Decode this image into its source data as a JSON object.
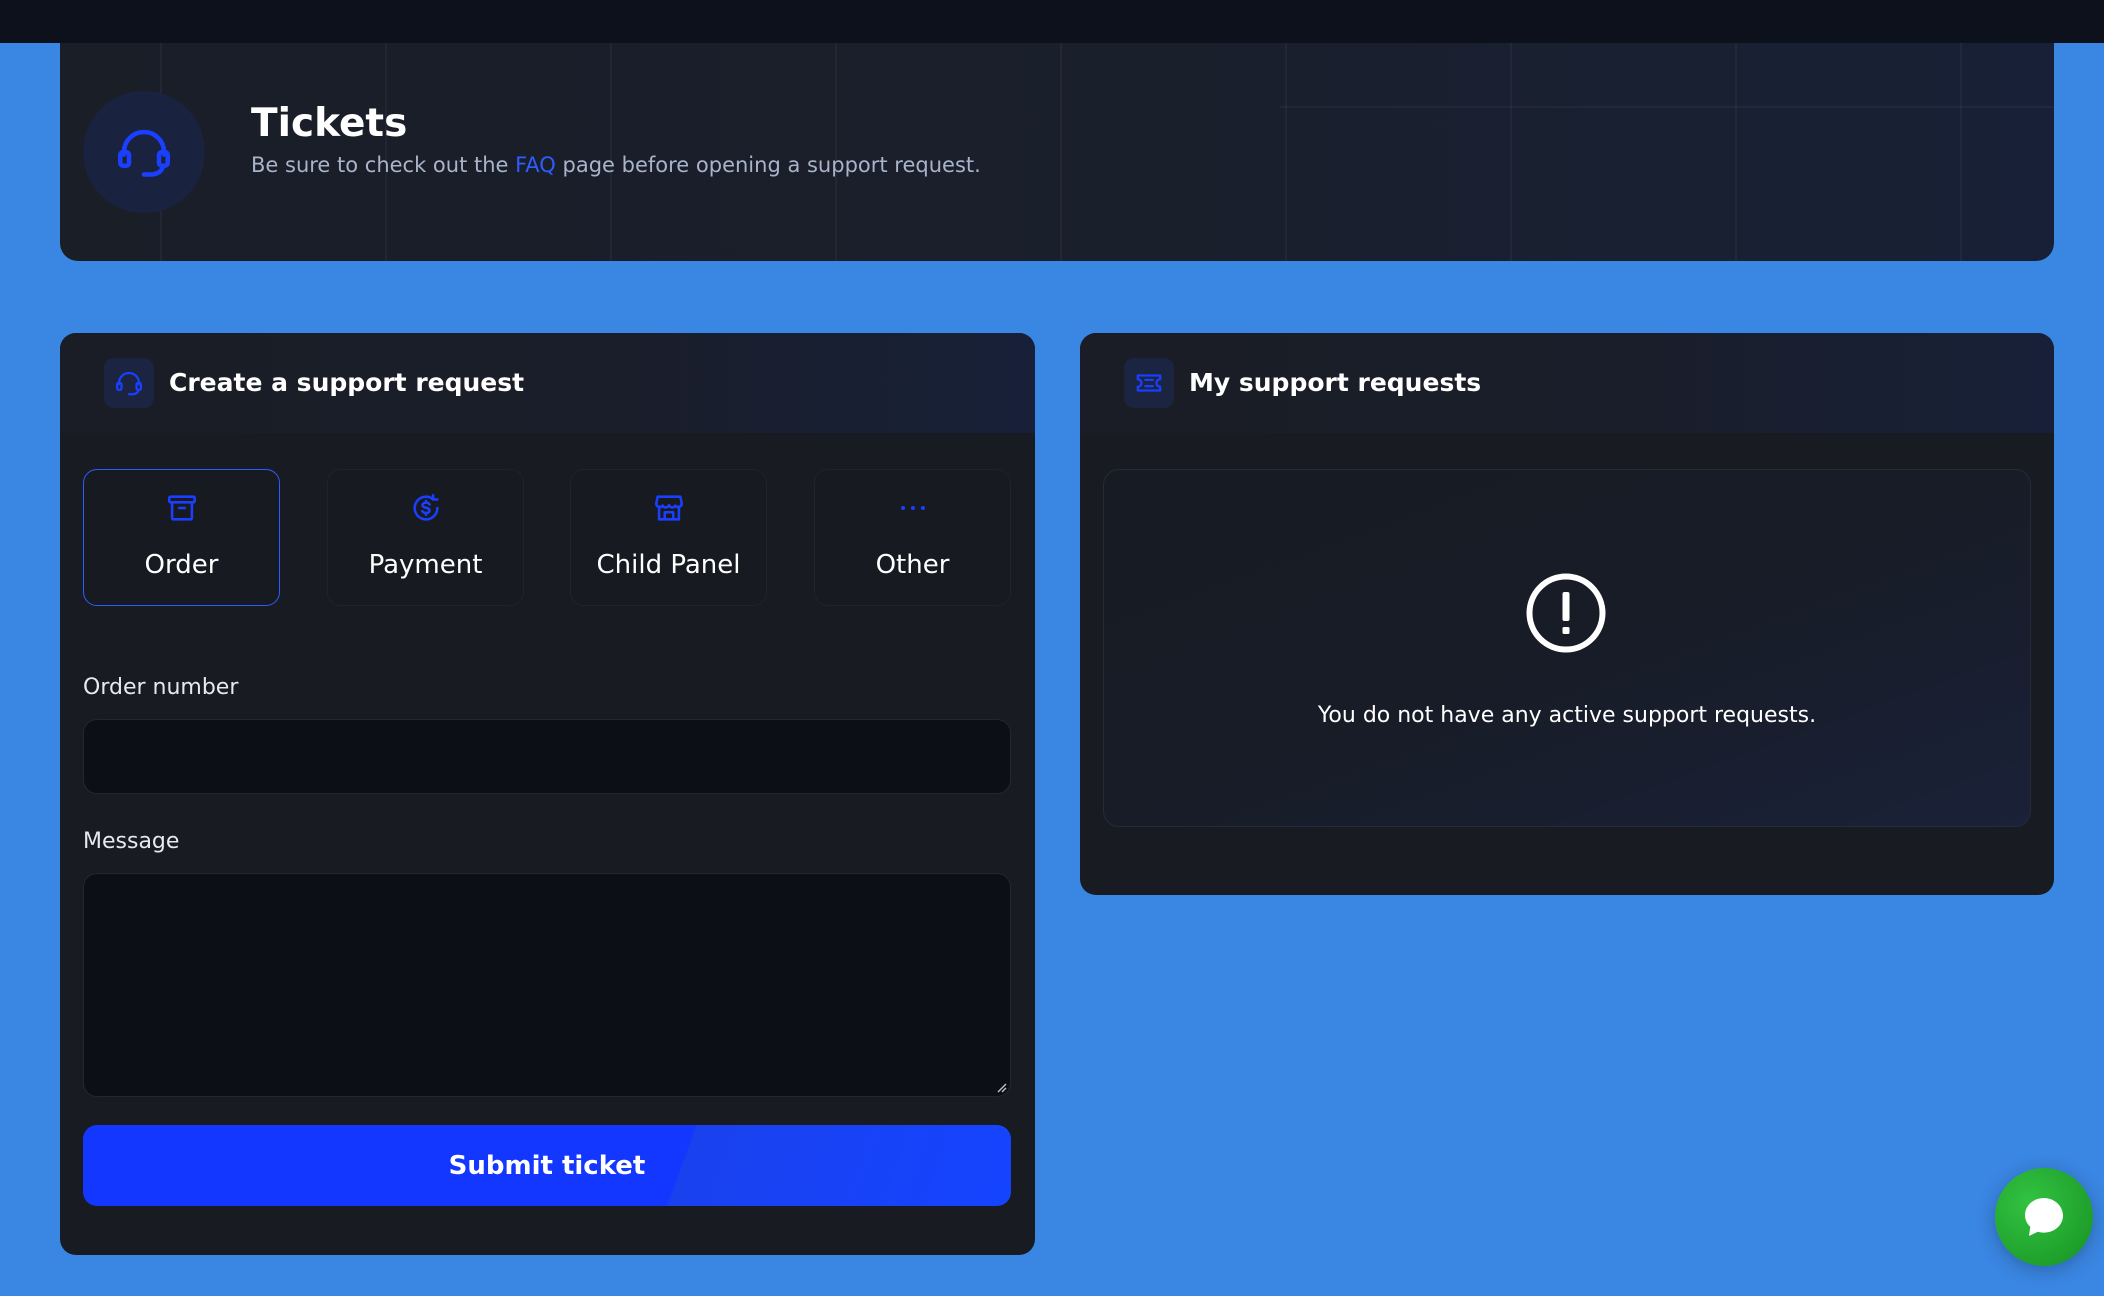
{
  "hero": {
    "title": "Tickets",
    "subtitle_before": "Be sure to check out the ",
    "subtitle_link": "FAQ",
    "subtitle_after": " page before opening a support request.",
    "icon": "headset-icon"
  },
  "create_card": {
    "title": "Create a support request",
    "icon": "headset-icon",
    "categories": [
      {
        "label": "Order",
        "icon": "archive-box-icon",
        "active": true
      },
      {
        "label": "Payment",
        "icon": "dollar-refresh-icon",
        "active": false
      },
      {
        "label": "Child Panel",
        "icon": "storefront-icon",
        "active": false
      },
      {
        "label": "Other",
        "icon": "ellipsis-icon",
        "active": false
      }
    ],
    "order_number_label": "Order number",
    "order_number_value": "",
    "message_label": "Message",
    "message_value": "",
    "submit_label": "Submit ticket"
  },
  "requests_card": {
    "title": "My support requests",
    "icon": "ticket-icon",
    "empty_text": "You do not have any active support requests.",
    "empty_icon": "exclamation-circle-icon"
  },
  "chat": {
    "icon": "chat-bubble-icon"
  },
  "colors": {
    "background": "#3a86e3",
    "panel": "#181b22",
    "accent": "#1337ff",
    "link": "#2e5cff",
    "chat": "#25a833"
  }
}
